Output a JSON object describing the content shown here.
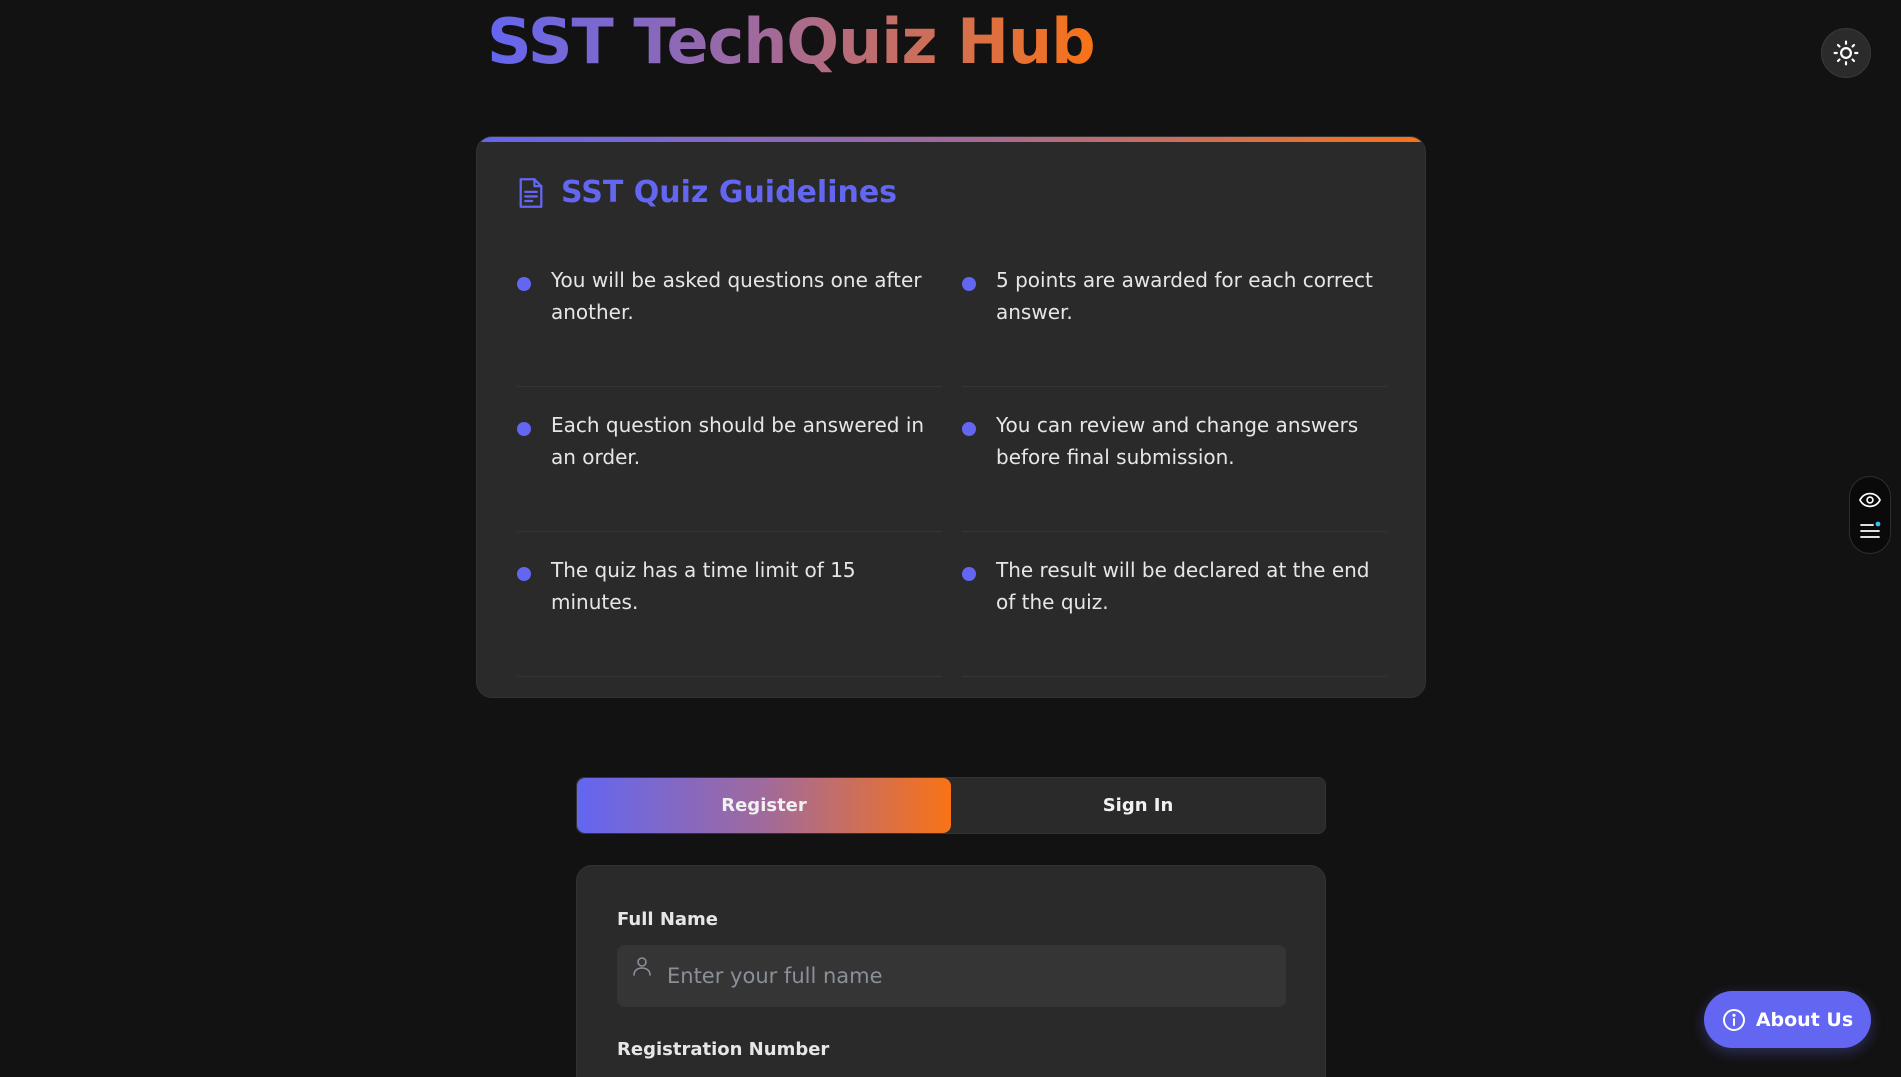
{
  "header": {
    "title": "SST TechQuiz Hub",
    "theme_toggle_icon": "sun-icon"
  },
  "guidelines": {
    "icon": "document-icon",
    "title": "SST Quiz Guidelines",
    "rules": [
      "You will be asked questions one after another.",
      "5 points are awarded for each correct answer.",
      "Each question should be answered in an order.",
      "You can review and change answers before final submission.",
      "The quiz has a time limit of 15 minutes.",
      "The result will be declared at the end of the quiz."
    ]
  },
  "auth": {
    "tabs": [
      {
        "label": "Register",
        "active": true
      },
      {
        "label": "Sign In",
        "active": false
      }
    ]
  },
  "form": {
    "full_name_label": "Full Name",
    "full_name_placeholder": "Enter your full name",
    "full_name_value": "",
    "registration_label": "Registration Number"
  },
  "side_widget": {
    "icons": [
      "eye-icon",
      "menu-lines-icon"
    ]
  },
  "about": {
    "label": "About Us",
    "icon": "info-icon"
  },
  "colors": {
    "accent": "#6366f1",
    "gradient_end": "#f97316",
    "background": "#121212",
    "card": "#2a2a2a"
  }
}
